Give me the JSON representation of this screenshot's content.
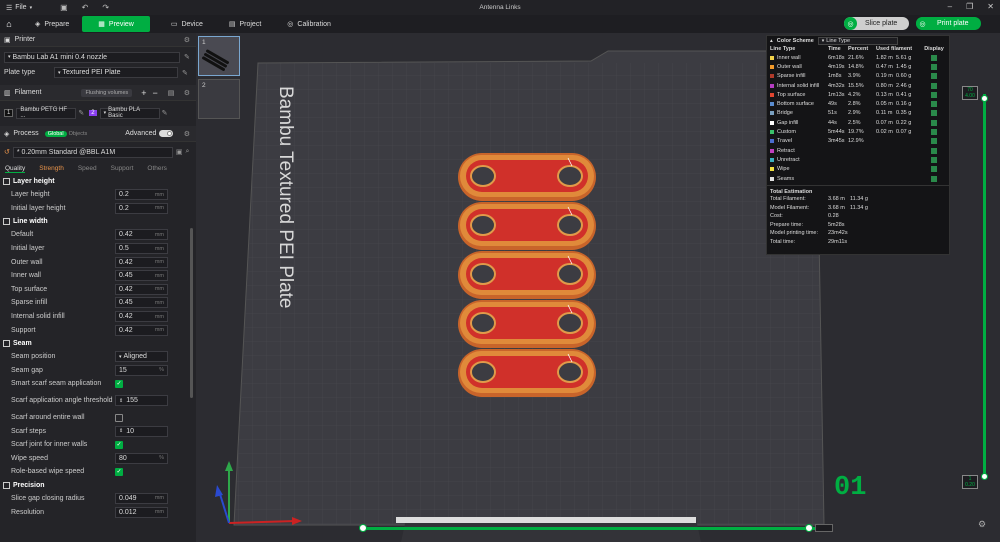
{
  "title_bar": {
    "menu_label": "File",
    "window_title": "Antenna Links"
  },
  "tabs": [
    {
      "label": "Prepare",
      "active": false
    },
    {
      "label": "Preview",
      "active": true
    },
    {
      "label": "Device",
      "active": false
    },
    {
      "label": "Project",
      "active": false
    },
    {
      "label": "Calibration",
      "active": false
    }
  ],
  "actions": {
    "slice_plate": "Slice plate",
    "print_plate": "Print plate"
  },
  "printer": {
    "section_label": "Printer",
    "printer_name": "Bambu Lab A1 mini 0.4 nozzle",
    "plate_type_label": "Plate type",
    "plate_type_value": "Textured PEI Plate"
  },
  "filament": {
    "section_label": "Filament",
    "flushing_label": "Flushing volumes",
    "slots": [
      {
        "index": "1",
        "name": "Bambu PETG HF ...",
        "color": "#1a1a1a"
      },
      {
        "index": "2",
        "name": "Bambu PLA Basic",
        "color": "#8a3ff0"
      }
    ]
  },
  "process": {
    "section_label": "Process",
    "global_label": "Global",
    "objects_label": "Objects",
    "advanced_label": "Advanced",
    "preset": "* 0.20mm Standard @BBL A1M",
    "subtabs": [
      "Quality",
      "Strength",
      "Speed",
      "Support",
      "Others"
    ]
  },
  "settings": {
    "layer_height_group": "Layer height",
    "layer_height_label": "Layer height",
    "layer_height": "0.2",
    "initial_layer_height_label": "Initial layer height",
    "initial_layer_height": "0.2",
    "line_width_group": "Line width",
    "default_label": "Default",
    "default": "0.42",
    "initial_layer_label": "Initial layer",
    "initial_layer": "0.5",
    "outer_wall_label": "Outer wall",
    "outer_wall": "0.42",
    "inner_wall_label": "Inner wall",
    "inner_wall": "0.45",
    "top_surface_label": "Top surface",
    "top_surface": "0.42",
    "sparse_infill_label": "Sparse infill",
    "sparse_infill": "0.45",
    "internal_solid_infill_label": "Internal solid infill",
    "internal_solid_infill": "0.42",
    "support_label": "Support",
    "support": "0.42",
    "seam_group": "Seam",
    "seam_position_label": "Seam position",
    "seam_position": "Aligned",
    "seam_gap_label": "Seam gap",
    "seam_gap": "15",
    "smart_scarf_label": "Smart scarf seam application",
    "scarf_angle_label": "Scarf application angle threshold",
    "scarf_angle": "155",
    "scarf_entire_label": "Scarf around entire wall",
    "scarf_steps_label": "Scarf steps",
    "scarf_steps": "10",
    "scarf_inner_label": "Scarf joint for inner walls",
    "wipe_speed_label": "Wipe speed",
    "wipe_speed": "80",
    "role_wipe_label": "Role-based wipe speed",
    "precision_group": "Precision",
    "slice_gap_label": "Slice gap closing radius",
    "slice_gap": "0.049",
    "resolution_label": "Resolution",
    "resolution": "0.012",
    "unit_mm": "mm",
    "unit_pct": "%",
    "unit_mms": "mm/s"
  },
  "plate": {
    "label": "Bambu Textured PEI Plate",
    "thumb_1": "1",
    "thumb_2": "2"
  },
  "legend": {
    "scheme_label": "Color Scheme",
    "scheme_value": "Line Type",
    "headers": [
      "Line Type",
      "Time",
      "Percent",
      "Used filament",
      "Display"
    ],
    "rows": [
      {
        "name": "Inner wall",
        "color": "#f2d34a",
        "time": "6m18s",
        "percent": "21.6%",
        "len": "1.82 m",
        "weight": "5.61 g"
      },
      {
        "name": "Outer wall",
        "color": "#f39a2a",
        "time": "4m19s",
        "percent": "14.8%",
        "len": "0.47 m",
        "weight": "1.45 g"
      },
      {
        "name": "Sparse infill",
        "color": "#b03a2a",
        "time": "1m8s",
        "percent": "3.9%",
        "len": "0.19 m",
        "weight": "0.60 g"
      },
      {
        "name": "Internal solid infill",
        "color": "#b43cc0",
        "time": "4m32s",
        "percent": "15.5%",
        "len": "0.80 m",
        "weight": "2.46 g"
      },
      {
        "name": "Top surface",
        "color": "#e0452f",
        "time": "1m13s",
        "percent": "4.2%",
        "len": "0.13 m",
        "weight": "0.41 g"
      },
      {
        "name": "Bottom surface",
        "color": "#5a8ccf",
        "time": "49s",
        "percent": "2.8%",
        "len": "0.05 m",
        "weight": "0.16 g"
      },
      {
        "name": "Bridge",
        "color": "#7aa0c0",
        "time": "51s",
        "percent": "2.9%",
        "len": "0.11 m",
        "weight": "0.35 g"
      },
      {
        "name": "Gap infill",
        "color": "#ffffff",
        "time": "44s",
        "percent": "2.5%",
        "len": "0.07 m",
        "weight": "0.22 g"
      },
      {
        "name": "Custom",
        "color": "#3ac06a",
        "time": "5m44s",
        "percent": "19.7%",
        "len": "0.02 m",
        "weight": "0.07 g"
      },
      {
        "name": "Travel",
        "color": "#4a6cd0",
        "time": "3m45s",
        "percent": "12.9%",
        "len": "",
        "weight": ""
      },
      {
        "name": "Retract",
        "color": "#c040c0",
        "time": "",
        "percent": "",
        "len": "",
        "weight": ""
      },
      {
        "name": "Unretract",
        "color": "#3ab0c0",
        "time": "",
        "percent": "",
        "len": "",
        "weight": ""
      },
      {
        "name": "Wipe",
        "color": "#f0e040",
        "time": "",
        "percent": "",
        "len": "",
        "weight": ""
      },
      {
        "name": "Seams",
        "color": "#e0e0e0",
        "time": "",
        "percent": "",
        "len": "",
        "weight": ""
      }
    ],
    "estimation_title": "Total Estimation",
    "estimation": [
      {
        "k": "Total Filament:",
        "v1": "3.68 m",
        "v2": "11.34 g"
      },
      {
        "k": "Model Filament:",
        "v1": "3.68 m",
        "v2": "11.34 g"
      },
      {
        "k": "Cost:",
        "v1": "0.28",
        "v2": ""
      },
      {
        "k": "Prepare time:",
        "v1": "5m28s",
        "v2": ""
      },
      {
        "k": "Model printing time:",
        "v1": "23m42s",
        "v2": ""
      },
      {
        "k": "Total time:",
        "v1": "29m11s",
        "v2": ""
      }
    ]
  },
  "layer_slider": {
    "top_layer": "70",
    "top_height": "4.00",
    "bottom_layer": "1",
    "bottom_height": "0.20",
    "current_layer_display": "01"
  }
}
